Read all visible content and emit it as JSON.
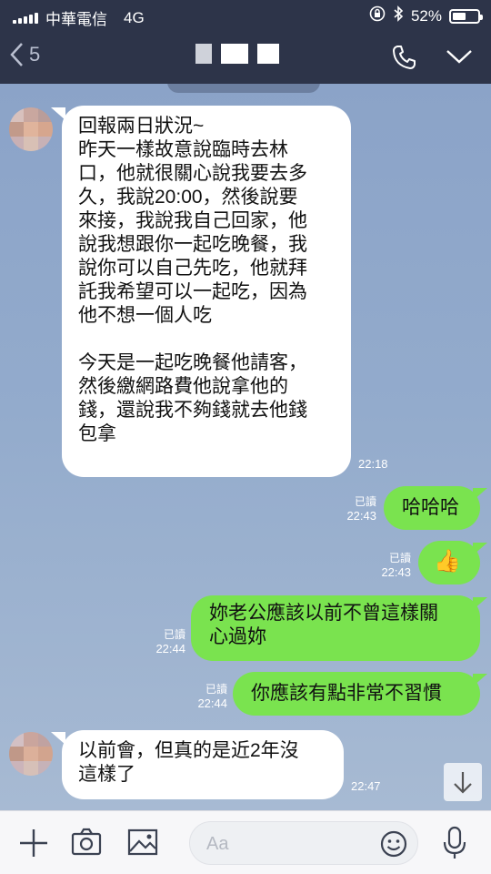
{
  "status_bar": {
    "carrier": "中華電信",
    "network": "4G",
    "battery_percent": "52%",
    "battery_level": 0.52,
    "icons": [
      "signal-icon",
      "lock-rotation-icon",
      "bluetooth-icon",
      "battery-icon"
    ]
  },
  "header": {
    "back_label": "5",
    "icons": [
      "back-chevron-icon",
      "phone-icon",
      "chevron-down-icon"
    ]
  },
  "messages": [
    {
      "direction": "in",
      "text": "回報兩日狀況~\n昨天一樣故意說臨時去林\n口，他就很關心說我要去多\n久，我說20:00，然後說要\n來接，我說我自己回家，他\n說我想跟你一起吃晚餐，我\n說你可以自己先吃，他就拜\n託我希望可以一起吃，因為\n他不想一個人吃\n\n今天是一起吃晚餐他請客，\n然後繳網路費他說拿他的\n錢，還說我不夠錢就去他錢\n包拿",
      "time": "22:18"
    },
    {
      "direction": "out",
      "text": "哈哈哈",
      "read": "已讀",
      "time": "22:43"
    },
    {
      "direction": "out",
      "text": "👍",
      "read": "已讀",
      "time": "22:43"
    },
    {
      "direction": "out",
      "text": "妳老公應該以前不曾這樣關\n心過妳",
      "read": "已讀",
      "time": "22:44"
    },
    {
      "direction": "out",
      "text": "你應該有點非常不習慣",
      "read": "已讀",
      "time": "22:44"
    },
    {
      "direction": "in",
      "text": "以前會，但真的是近2年沒\n這樣了",
      "time": "22:47"
    }
  ],
  "input_bar": {
    "placeholder": "Aa",
    "icons": [
      "plus-icon",
      "camera-icon",
      "image-icon",
      "emoji-icon",
      "microphone-icon"
    ]
  },
  "colors": {
    "header_bg": "#2d3449",
    "chat_bg": "#8ba3c8",
    "outgoing_bubble": "#7ae34f",
    "incoming_bubble": "#ffffff"
  }
}
